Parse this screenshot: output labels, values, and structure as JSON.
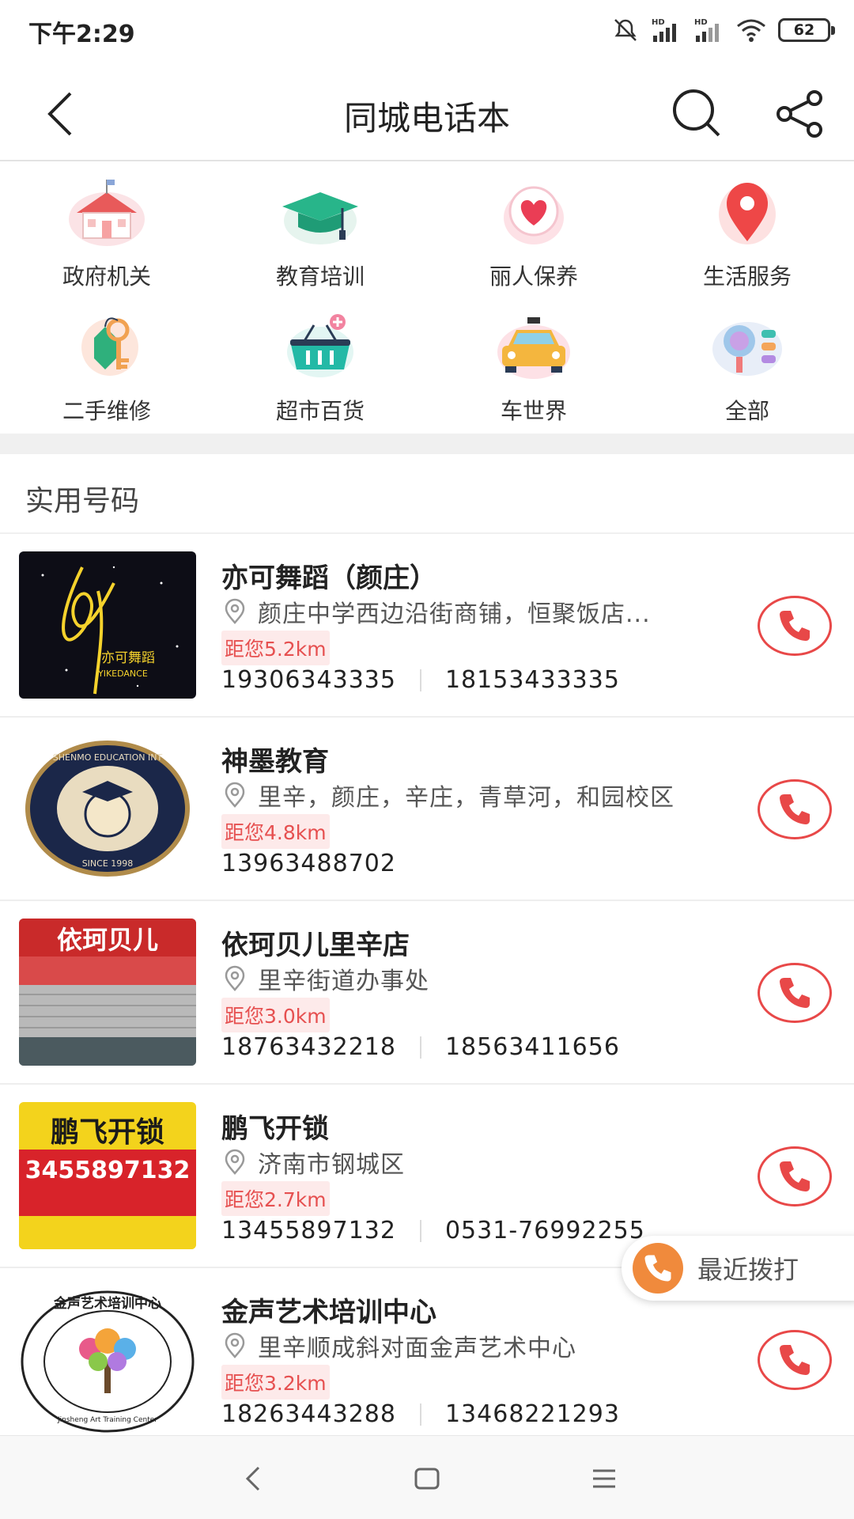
{
  "status_bar": {
    "time": "下午2:29",
    "battery": "62"
  },
  "header": {
    "title": "同城电话本"
  },
  "categories": [
    {
      "label": "政府机关",
      "icon": "government-building-icon"
    },
    {
      "label": "教育培训",
      "icon": "graduation-cap-icon"
    },
    {
      "label": "丽人保养",
      "icon": "heart-icon"
    },
    {
      "label": "生活服务",
      "icon": "location-pin-icon"
    },
    {
      "label": "二手维修",
      "icon": "key-tag-icon"
    },
    {
      "label": "超市百货",
      "icon": "shopping-basket-icon"
    },
    {
      "label": "车世界",
      "icon": "taxi-car-icon"
    },
    {
      "label": "全部",
      "icon": "all-categories-icon"
    }
  ],
  "section": {
    "title": "实用号码"
  },
  "listings": [
    {
      "name": "亦可舞蹈（颜庄）",
      "address": "颜庄中学西边沿街商铺，恒聚饭店...",
      "distance": "距您5.2km",
      "phones": [
        "19306343335",
        "18153433335"
      ],
      "thumb_text": "亦可舞蹈",
      "thumb_sub": "YIKEDANCE"
    },
    {
      "name": "神墨教育",
      "address": "里辛，颜庄，辛庄，青草河，和园校区",
      "distance": "距您4.8km",
      "phones": [
        "13963488702"
      ],
      "thumb_text": "SHENMO EDUCATION INT",
      "thumb_sub": "SINCE 1998"
    },
    {
      "name": "依珂贝儿里辛店",
      "address": "里辛街道办事处",
      "distance": "距您3.0km",
      "phones": [
        "18763432218",
        "18563411656"
      ],
      "thumb_text": "依珂贝儿",
      "thumb_sub": ""
    },
    {
      "name": "鹏飞开锁",
      "address": "济南市钢城区",
      "distance": "距您2.7km",
      "phones": [
        "13455897132",
        "0531-76992255"
      ],
      "thumb_text": "鹏飞开锁",
      "thumb_sub": "3455897132"
    },
    {
      "name": "金声艺术培训中心",
      "address": "里辛顺成斜对面金声艺术中心",
      "distance": "距您3.2km",
      "phones": [
        "18263443288",
        "13468221293"
      ],
      "thumb_text": "金声艺术培训中心",
      "thumb_sub": "Jinsheng Art Training Center"
    }
  ],
  "recent_calls": {
    "label": "最近拨打"
  },
  "colors": {
    "accent_red": "#e84848",
    "distance_bg": "#fdeaea",
    "recent_orange": "#f08a3c"
  }
}
